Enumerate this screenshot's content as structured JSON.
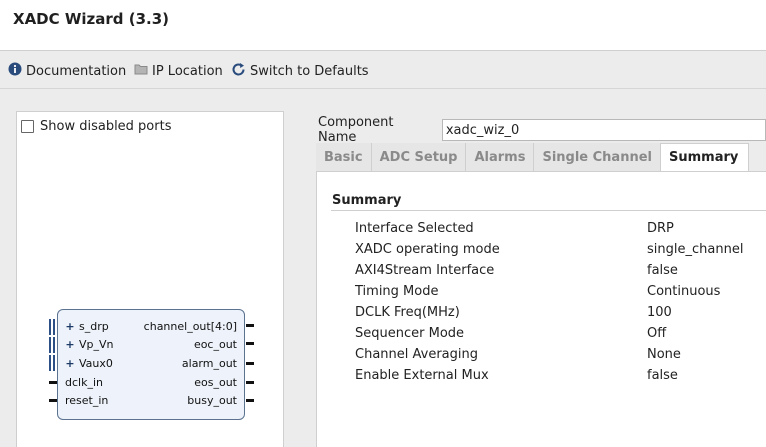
{
  "window": {
    "title": "XADC Wizard (3.3)"
  },
  "toolbar": {
    "documentation": "Documentation",
    "ip_location": "IP Location",
    "switch_defaults": "Switch to Defaults"
  },
  "left": {
    "show_disabled_ports": "Show disabled ports",
    "block": {
      "left_ports": [
        "s_drp",
        "Vp_Vn",
        "Vaux0",
        "dclk_in",
        "reset_in"
      ],
      "right_ports": [
        "channel_out[4:0]",
        "eoc_out",
        "alarm_out",
        "eos_out",
        "busy_out"
      ]
    }
  },
  "component": {
    "label": "Component Name",
    "value": "xadc_wiz_0"
  },
  "tabs": [
    "Basic",
    "ADC Setup",
    "Alarms",
    "Single Channel",
    "Summary"
  ],
  "summary": {
    "title": "Summary",
    "rows": [
      {
        "key": "Interface Selected",
        "value": "DRP"
      },
      {
        "key": "XADC operating mode",
        "value": "single_channel"
      },
      {
        "key": "AXI4Stream Interface",
        "value": "false"
      },
      {
        "key": "Timing Mode",
        "value": "Continuous"
      },
      {
        "key": "DCLK Freq(MHz)",
        "value": "100"
      },
      {
        "key": "Sequencer Mode",
        "value": "Off"
      },
      {
        "key": "Channel Averaging",
        "value": "None"
      },
      {
        "key": "Enable External Mux",
        "value": "false"
      }
    ]
  }
}
